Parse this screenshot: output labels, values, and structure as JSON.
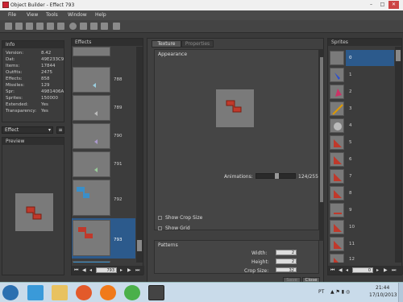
{
  "window": {
    "title": "Object Builder - Effect 793",
    "min_label": "–",
    "max_label": "□",
    "close_label": "✕"
  },
  "menu": [
    "File",
    "View",
    "Tools",
    "Window",
    "Help"
  ],
  "info": {
    "title": "Info",
    "rows": [
      {
        "label": "Version:",
        "value": "8.42"
      },
      {
        "label": "Dat:",
        "value": "49E233C9"
      },
      {
        "label": "Items:",
        "value": "17844"
      },
      {
        "label": "Outfits:",
        "value": "2475"
      },
      {
        "label": "Effects:",
        "value": "858"
      },
      {
        "label": "Missiles:",
        "value": "129"
      },
      {
        "label": "Spr:",
        "value": "4981406A"
      },
      {
        "label": "Sprites:",
        "value": "150000"
      },
      {
        "label": "Extended:",
        "value": "Yes"
      },
      {
        "label": "Transparency:",
        "value": "Yes"
      }
    ]
  },
  "category_select": {
    "value": "Effect"
  },
  "preview": {
    "title": "Preview"
  },
  "effects": {
    "title": "Effects",
    "items": [
      "788",
      "789",
      "790",
      "791",
      "792",
      "793"
    ],
    "selected": "793",
    "page_value": "793"
  },
  "editor": {
    "tabs": [
      "Texture",
      "Properties"
    ],
    "active_tab": "Texture",
    "appearance_title": "Appearance",
    "animations_label": "Animations:",
    "animations_value": "124/255",
    "show_crop_size": "Show Crop Size",
    "show_grid": "Show Grid",
    "patterns_title": "Patterns",
    "width_label": "Width:",
    "width_value": "2",
    "height_label": "Height:",
    "height_value": "2",
    "crop_label": "Crop Size:",
    "crop_value": "32",
    "save_label": "Save",
    "close_label": "Close"
  },
  "sprites": {
    "title": "Sprites",
    "items": [
      "0",
      "1",
      "2",
      "3",
      "4",
      "5",
      "6",
      "7",
      "8",
      "9",
      "10",
      "11",
      "12"
    ],
    "selected": "0",
    "page_value": "0"
  },
  "taskbar": {
    "lang": "PT",
    "time": "21:44",
    "date": "17/10/2013"
  },
  "colors": {
    "selection": "#2c5a8c",
    "accent_red": "#c0392b"
  }
}
